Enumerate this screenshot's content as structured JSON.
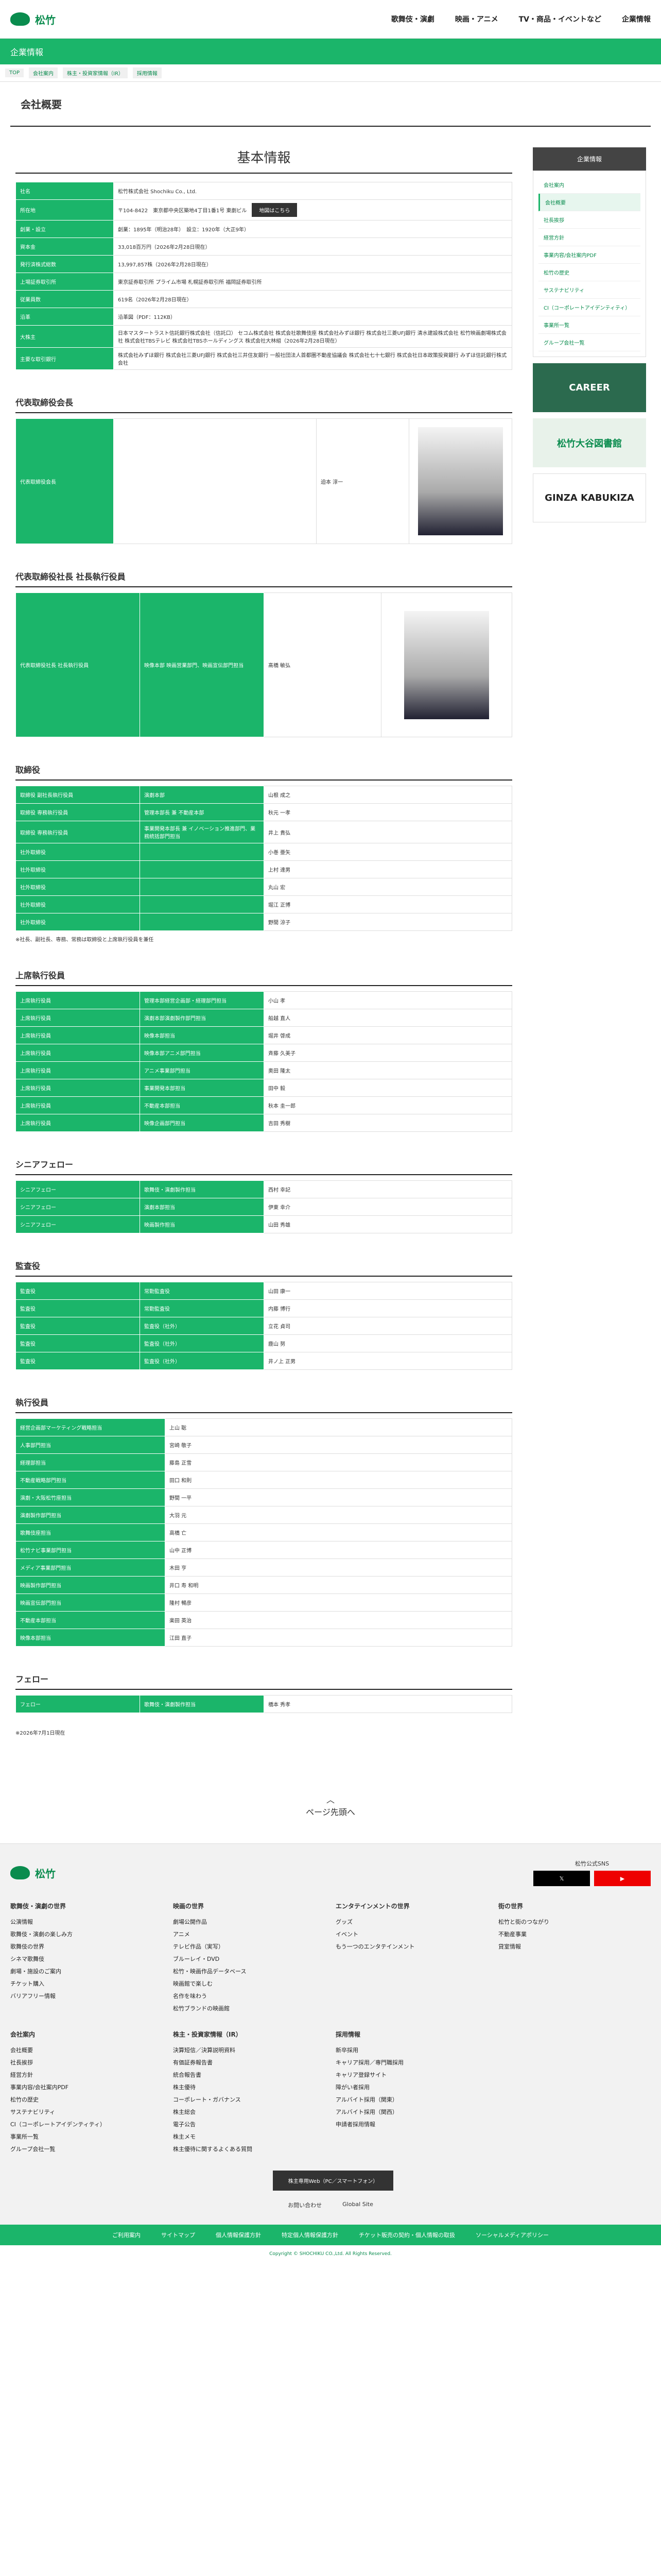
{
  "header": {
    "logo": "松竹",
    "nav": [
      "歌舞伎・演劇",
      "映画・アニメ",
      "TV・商品・イベントなど",
      "企業情報"
    ]
  },
  "section": {
    "title": "企業情報"
  },
  "crumbs": [
    "TOP",
    "会社案内",
    "株主・投資家情報（IR）",
    "採用情報"
  ],
  "page_title": "会社概要",
  "basic": {
    "title": "基本情報",
    "rows": [
      [
        "社名",
        "松竹株式会社 Shochiku Co., Ltd."
      ],
      [
        "所在地",
        "〒104-8422　東京都中央区築地4丁目1番1号 東劇ビル"
      ],
      [
        "創業・設立",
        "創業：1895年（明治28年）　設立：1920年（大正9年）"
      ],
      [
        "資本金",
        "33,018百万円（2026年2月28日現在）"
      ],
      [
        "発行済株式総数",
        "13,997,857株（2026年2月28日現在）"
      ],
      [
        "上場証券取引所",
        "東京証券取引所 プライム市場 札幌証券取引所 福岡証券取引所"
      ],
      [
        "従業員数",
        "619名（2026年2月28日現在）"
      ],
      [
        "沿革",
        "沿革図（PDF：112KB）"
      ],
      [
        "大株主",
        "日本マスタートラスト信託銀行株式会社（信託口） セコム株式会社 株式会社歌舞伎座 株式会社みずほ銀行 株式会社三菱UFJ銀行 清水建設株式会社 松竹映画劇場株式会社 株式会社TBSテレビ 株式会社TBSホールディングス 株式会社大林組（2026年2月28日現在）"
      ],
      [
        "主要な取引銀行",
        "株式会社みずほ銀行 株式会社三菱UFJ銀行 株式会社三井住友銀行 一般社団法人首都圏不動産協議会 株式会社七十七銀行 株式会社日本政策投資銀行 みずほ信託銀行株式会社"
      ]
    ],
    "map_button": "地図はこちら"
  },
  "rep": {
    "title": "代表取締役会長",
    "role": "代表取締役会長",
    "name": "迫本 淳一"
  },
  "pres": {
    "title": "代表取締役社長 社長執行役員",
    "role": "代表取締役社長 社長執行役員",
    "duty": "映像本部 映画営業部門、映画宣伝部門担当",
    "name": "髙橋 敏弘"
  },
  "board": {
    "title": "取締役",
    "rows": [
      [
        "取締役 副社長執行役員",
        "演劇本部",
        "山根 成之"
      ],
      [
        "取締役 専務執行役員",
        "管理本部長 兼 不動産本部",
        "秋元 一孝"
      ],
      [
        "取締役 専務執行役員",
        "事業開発本部長 兼 イノベーション推進部門、業務統括部門担当",
        "井上 貴弘"
      ],
      [
        "社外取締役",
        "",
        "小巻 亜矢"
      ],
      [
        "社外取締役",
        "",
        "上村 達男"
      ],
      [
        "社外取締役",
        "",
        "丸山 宏"
      ],
      [
        "社外取締役",
        "",
        "堀江 正博"
      ],
      [
        "社外取締役",
        "",
        "野間 涼子"
      ]
    ],
    "note": "※社長、副社長、専務、常務は取締役と上席執行役員を兼任"
  },
  "senior": {
    "title": "上席執行役員",
    "rows": [
      [
        "上席執行役員",
        "管理本部経営企画部・経理部門担当",
        "小山 孝"
      ],
      [
        "上席執行役員",
        "演劇本部演劇製作部門担当",
        "船越 直人"
      ],
      [
        "上席執行役員",
        "映像本部担当",
        "堀井 啓成"
      ],
      [
        "上席執行役員",
        "映像本部アニメ部門担当",
        "斉藤 久美子"
      ],
      [
        "上席執行役員",
        "アニメ事業部門担当",
        "奥田 隆太"
      ],
      [
        "上席執行役員",
        "事業開発本部担当",
        "田中 毅"
      ],
      [
        "上席執行役員",
        "不動産本部担当",
        "秋本 圭一郎"
      ],
      [
        "上席執行役員",
        "映像企画部門担当",
        "吉田 秀樹"
      ]
    ]
  },
  "fellow": {
    "title": "シニアフェロー",
    "rows": [
      [
        "シニアフェロー",
        "歌舞伎・演劇製作担当",
        "西村 幸記"
      ],
      [
        "シニアフェロー",
        "演劇本部担当",
        "伊東 幸介"
      ],
      [
        "シニアフェロー",
        "映画製作担当",
        "山田 秀雄"
      ]
    ]
  },
  "audit": {
    "title": "監査役",
    "rows": [
      [
        "監査役",
        "常勤監査役",
        "山田 康一"
      ],
      [
        "監査役",
        "常勤監査役",
        "内藤 博行"
      ],
      [
        "監査役",
        "監査役（社外）",
        "立花 貞司"
      ],
      [
        "監査役",
        "監査役（社外）",
        "鹿山 努"
      ],
      [
        "監査役",
        "監査役（社外）",
        "井ノ上 正男"
      ]
    ]
  },
  "exec": {
    "title": "執行役員",
    "rows": [
      [
        "経営企画部マーケティング戦略担当",
        "上山 聡"
      ],
      [
        "人事部門担当",
        "宮崎 敬子"
      ],
      [
        "経理部担当",
        "藤島 正雪"
      ],
      [
        "不動産戦略部門担当",
        "田口 和則"
      ],
      [
        "演劇・大阪松竹座担当",
        "野間 一平"
      ],
      [
        "演劇製作部門担当",
        "大羽 元"
      ],
      [
        "歌舞伎座担当",
        "高橋 亡"
      ],
      [
        "松竹ナビ事業部門担当",
        "山中 正博"
      ],
      [
        "メディア事業部門担当",
        "木田 亨"
      ],
      [
        "映画製作部門担当",
        "井口 寿 和明"
      ],
      [
        "映画宣伝部門担当",
        "隆村 暢彦"
      ],
      [
        "不動産本部担当",
        "楽田 英治"
      ],
      [
        "映像本部担当",
        "江田 直子"
      ]
    ]
  },
  "follow": {
    "title": "フェロー",
    "rows": [
      [
        "フェロー",
        "歌舞伎・演劇製作担当",
        "橋本 秀孝"
      ]
    ]
  },
  "date_note": "※2026年7月1日現在",
  "side": {
    "head": "企業情報",
    "items": [
      "会社案内",
      "会社概要",
      "社長挨拶",
      "経営方針",
      "事業内容/会社案内PDF",
      "松竹の歴史",
      "サステナビリティ",
      "CI（コーポレートアイデンティティ）",
      "事業所一覧",
      "グループ会社一覧"
    ],
    "banners": [
      "CAREER",
      "松竹大谷図書館",
      "GINZA KABUKIZA"
    ]
  },
  "pageup": "ページ先頭へ",
  "footer": {
    "sns_label": "松竹公式SNS",
    "cols": [
      {
        "h": "歌舞伎・演劇の世界",
        "items": [
          "公演情報",
          "歌舞伎・演劇の楽しみ方",
          "歌舞伎の世界",
          "シネマ歌舞伎",
          "劇場・施設のご案内",
          "チケット購入",
          "バリアフリー情報"
        ]
      },
      {
        "h": "映画の世界",
        "items": [
          "劇場公開作品",
          "アニメ",
          "テレビ作品（実写）",
          "ブルーレイ・DVD",
          "松竹・映画作品データベース",
          "映画館で楽しむ",
          "名作を味わう",
          "松竹ブランドの映画館"
        ]
      },
      {
        "h": "エンタテインメントの世界",
        "items": [
          "グッズ",
          "イベント",
          "もう一つのエンタテインメント"
        ]
      },
      {
        "h": "街の世界",
        "items": [
          "松竹と街のつながり",
          "不動産事業",
          "貸室情報"
        ]
      }
    ],
    "cols2": [
      {
        "h": "会社案内",
        "items": [
          "会社概要",
          "社長挨拶",
          "経営方針",
          "事業内容/会社案内PDF",
          "松竹の歴史",
          "サステナビリティ",
          "CI（コーポレートアイデンティティ）",
          "事業所一覧",
          "グループ会社一覧"
        ]
      },
      {
        "h": "株主・投資家情報（IR）",
        "items": [
          "決算短信／決算説明資料",
          "有価証券報告書",
          "統合報告書",
          "株主優待",
          "コーポレート・ガバナンス",
          "株主総会",
          "電子公告",
          "株主メモ",
          "株主優待に関するよくある質問"
        ]
      },
      {
        "h": "採用情報",
        "items": [
          "新卒採用",
          "キャリア採用／専門職採用",
          "キャリア登録サイト",
          "障がい者採用",
          "アルバイト採用（関東）",
          "アルバイト採用（関西）",
          "申請者採用情報"
        ]
      },
      {
        "h": "",
        "items": []
      }
    ],
    "ir_button": "株主専用Web（PC／スマートフォン）",
    "links": [
      "お問い合わせ",
      "Global Site"
    ],
    "bottom": [
      "ご利用案内",
      "サイトマップ",
      "個人情報保護方針",
      "特定個人情報保護方針",
      "チケット販売の契約・個人情報の取扱",
      "ソーシャルメディアポリシー"
    ],
    "copyright": "Copyright © SHOCHIKU CO.,Ltd. All Rights Reserved."
  }
}
